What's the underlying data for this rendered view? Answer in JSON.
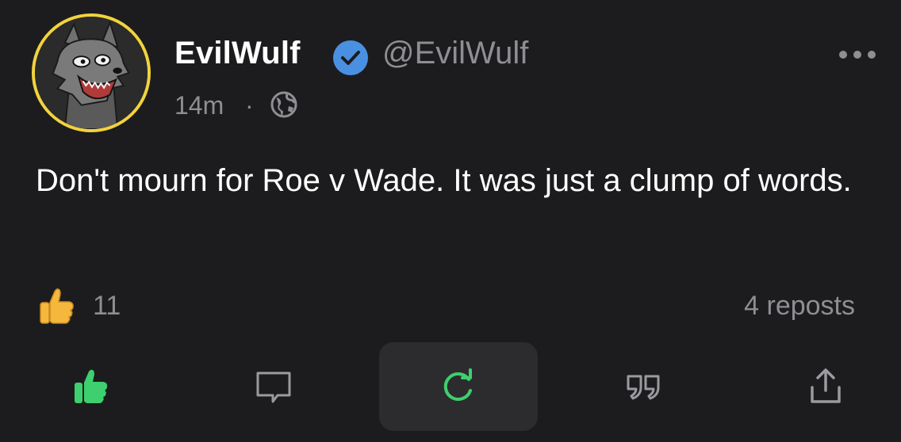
{
  "author": {
    "display_name": "EvilWulf",
    "handle": "@EvilWulf",
    "verified": true,
    "avatar_ring_color": "#f2d33c",
    "verified_color": "#4a90e2"
  },
  "meta": {
    "timestamp": "14m",
    "separator": "·",
    "visibility_icon": "globe-icon"
  },
  "post": {
    "text": "Don't mourn for Roe v Wade. It was just a clump of words."
  },
  "stats": {
    "like_emoji": "thumbs-up-emoji",
    "like_count": "11",
    "reposts": "4 reposts"
  },
  "actions": [
    {
      "name": "like",
      "icon": "thumbs-up-icon",
      "color": "#3ecf6e",
      "active": true
    },
    {
      "name": "reply",
      "icon": "comment-icon",
      "color": "#9a9a9f"
    },
    {
      "name": "repost",
      "icon": "repost-icon",
      "color": "#3ecf6e",
      "highlighted": true
    },
    {
      "name": "quote",
      "icon": "quote-icon",
      "color": "#9a9a9f"
    },
    {
      "name": "share",
      "icon": "share-icon",
      "color": "#9a9a9f"
    }
  ],
  "menu_icon": "more-horizontal-icon"
}
